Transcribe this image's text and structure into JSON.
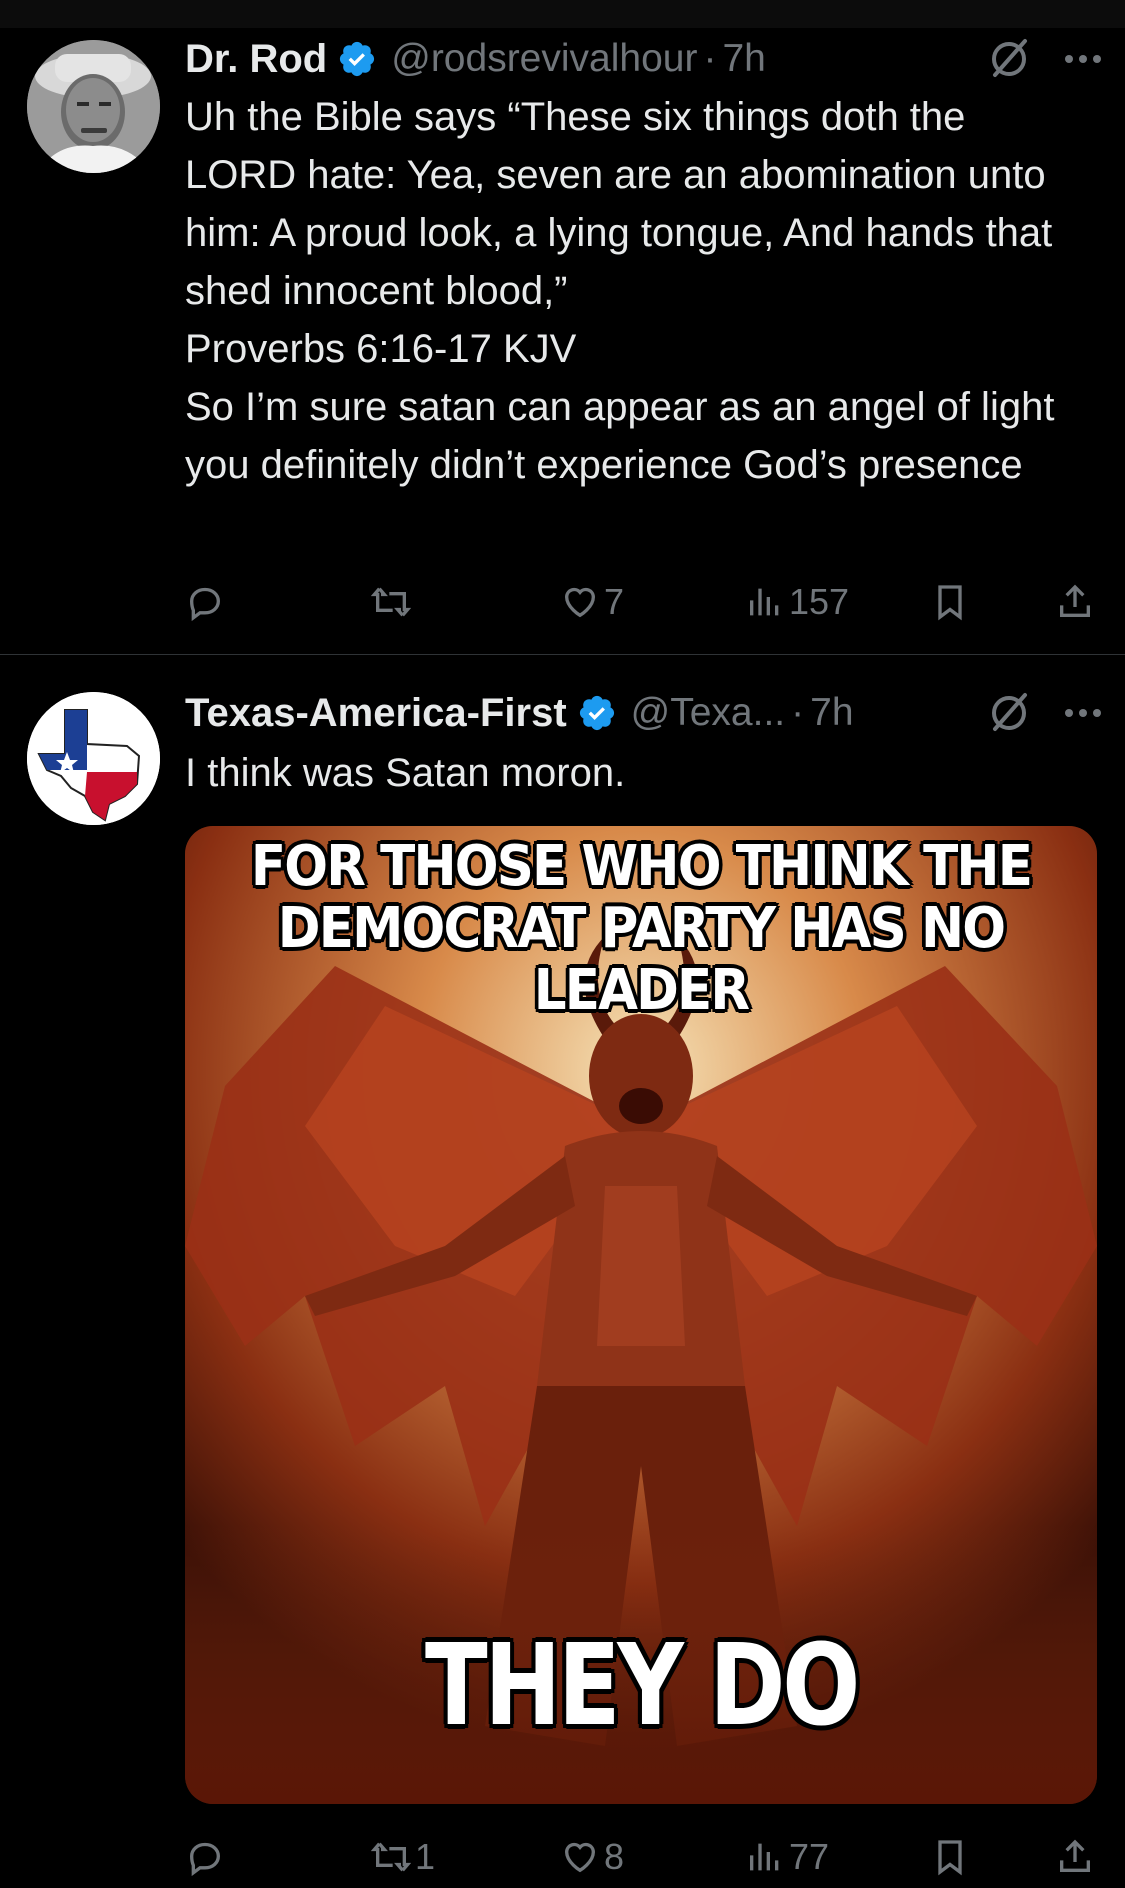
{
  "tweets": [
    {
      "author_name": "Dr. Rod",
      "handle": "@rodsrevivalhour",
      "separator": "·",
      "time": "7h",
      "text": "Uh the Bible says “These six things doth the LORD hate: Yea, seven are an abomination unto him: A proud look, a lying tongue, And hands that shed innocent blood,”\nProverbs 6:16-17 KJV\nSo I’m sure satan can appear as an angel of light you definitely didn’t experience God’s presence",
      "actions": {
        "replies": "",
        "reposts": "",
        "likes": "7",
        "views": "157"
      }
    },
    {
      "author_name": "Texas-America-First",
      "handle": "@Texa...",
      "separator": "·",
      "time": "7h",
      "text": "I think was Satan moron.",
      "media": {
        "top_line_1": "FOR THOSE WHO THINK THE",
        "top_line_2": "DEMOCRAT PARTY HAS NO LEADER",
        "bottom_text": "THEY DO"
      },
      "actions": {
        "replies": "",
        "reposts": "1",
        "likes": "8",
        "views": "77"
      }
    }
  ],
  "colors": {
    "background": "#000000",
    "text": "#e7e9ea",
    "secondary": "#71767b",
    "verified": "#1d9bf0",
    "divider": "#2f3336"
  },
  "icons": [
    "verified-badge-icon",
    "grok-icon",
    "more-icon",
    "reply-icon",
    "retweet-icon",
    "like-icon",
    "views-icon",
    "bookmark-icon",
    "share-icon"
  ]
}
